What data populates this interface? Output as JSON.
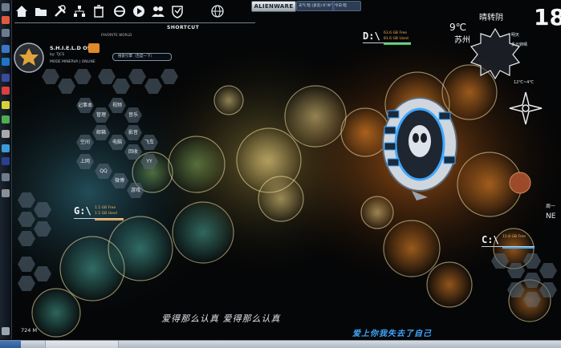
{
  "top_toolbar": {
    "tools": [
      {
        "name": "home-icon",
        "label": ""
      },
      {
        "name": "folder-icon",
        "label": ""
      },
      {
        "name": "tools-icon",
        "label": ""
      },
      {
        "name": "network-icon",
        "label": ""
      },
      {
        "name": "trash-icon",
        "label": ""
      },
      {
        "name": "ie-icon",
        "label": ""
      },
      {
        "name": "media-icon",
        "label": ""
      },
      {
        "name": "users-icon",
        "label": ""
      },
      {
        "name": "shield-icon",
        "label": ""
      },
      {
        "name": "globe-icon",
        "label": ""
      }
    ],
    "shortcut_label": "SHORTCUT",
    "favorite_label": "FAVORITE WORLD",
    "alienware_label": "ALIENWARE",
    "pill_left": "天气 暗 (多云) 6°/8°",
    "pill_right": "今日 暗"
  },
  "shield": {
    "title": "S.H.I.E.L.D OS",
    "subtitle": "by: TJCS",
    "status": "MODE MINERVA  |  ONLINE"
  },
  "search": {
    "placeholder": "搜索引擎（百度一下）"
  },
  "hex_grid": [
    {
      "label": "记事本"
    },
    {
      "label": "视频"
    },
    {
      "label": "管理"
    },
    {
      "label": "音乐"
    },
    {
      "label": "邮箱"
    },
    {
      "label": "影音"
    },
    {
      "label": "空间"
    },
    {
      "label": "电脑"
    },
    {
      "label": "飞车"
    },
    {
      "label": "回收"
    },
    {
      "label": "YY"
    },
    {
      "label": "上网"
    },
    {
      "label": "QQ"
    },
    {
      "label": "微博"
    },
    {
      "label": "游戏"
    }
  ],
  "drives": {
    "d": {
      "label": "D:\\",
      "free": "63.6 GB Free",
      "used": "81.6 GB Used"
    },
    "g": {
      "label": "G:\\",
      "free": "1.5 GB Free",
      "used": "1.5 GB Used"
    },
    "c": {
      "label": "C:\\",
      "free": "15.8 GB Free",
      "used": "15.8 GB Used"
    }
  },
  "weather": {
    "condition": "晴转阴",
    "temperature": "9℃",
    "city": "苏州",
    "day_big": "18",
    "side_lines": [
      "明天",
      "多云转晴",
      "12℃~4℃"
    ],
    "far_right": [
      "周一",
      "NE"
    ]
  },
  "lyrics": {
    "center": "爱得那么认真 爱得那么认真",
    "right": "爱上你我失去了自己"
  },
  "memory": "724 M",
  "colors": {
    "accent_blue": "#3fa8ff",
    "drive_orange": "#f1a040",
    "drive_green": "#39d353"
  }
}
